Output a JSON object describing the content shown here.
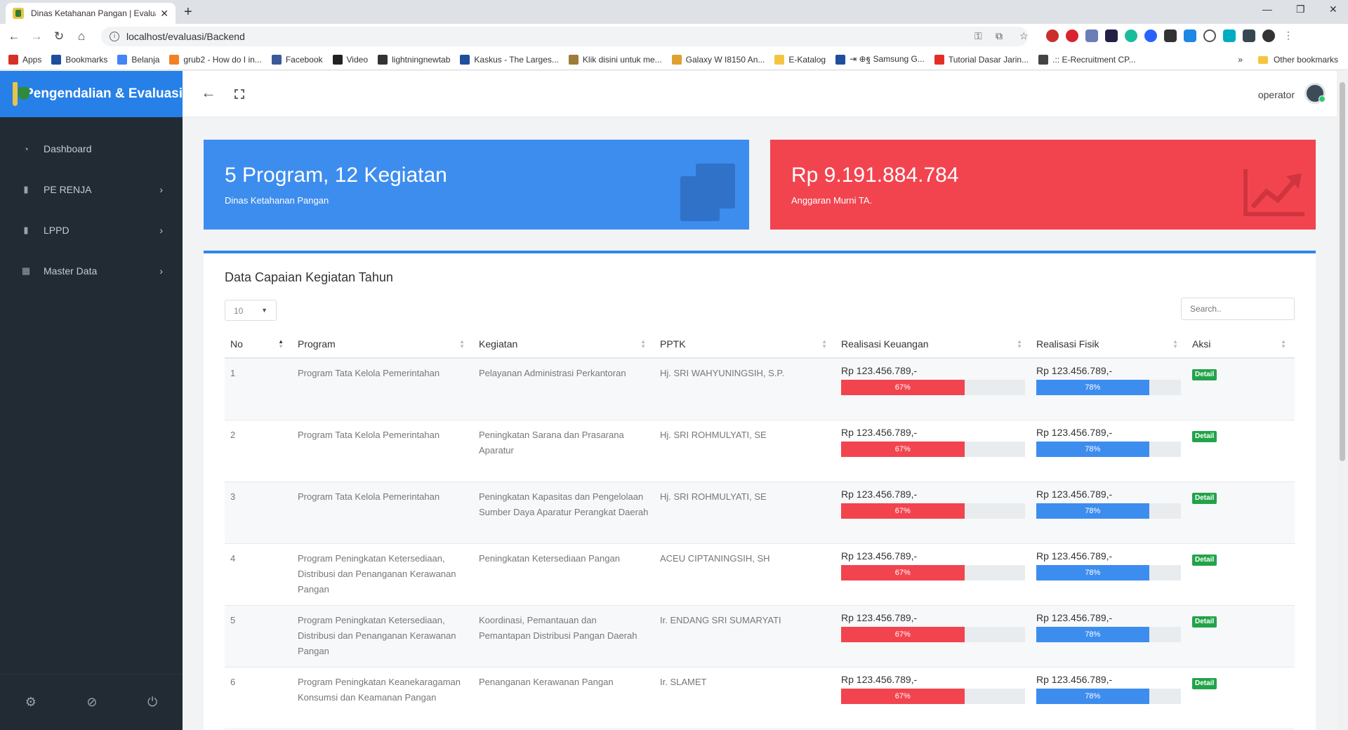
{
  "browser": {
    "tab_title": "Dinas Ketahanan Pangan | Evaluasi",
    "url": "localhost/evaluasi/Backend",
    "bookmarks": [
      {
        "label": "Apps",
        "color": "#d93025"
      },
      {
        "label": "Bookmarks",
        "color": "#1f4e9c"
      },
      {
        "label": "Belanja",
        "color": "#4285f4"
      },
      {
        "label": "grub2 - How do I in...",
        "color": "#f48024"
      },
      {
        "label": "Facebook",
        "color": "#3b5998"
      },
      {
        "label": "Video",
        "color": "#222"
      },
      {
        "label": "lightningnewtab",
        "color": "#333"
      },
      {
        "label": "Kaskus - The Larges...",
        "color": "#1f4e9c"
      },
      {
        "label": "Klik disini untuk me...",
        "color": "#9c7b3b"
      },
      {
        "label": "Galaxy W I8150 An...",
        "color": "#e0a030"
      },
      {
        "label": "E-Katalog",
        "color": "#f5c542"
      },
      {
        "label": "⇥ ⊕ฐ Samsung G...",
        "color": "#1f4e9c"
      },
      {
        "label": "Tutorial Dasar Jarin...",
        "color": "#e52d27"
      },
      {
        "label": ".:: E-Recruitment CP...",
        "color": "#444"
      }
    ],
    "overflow": "»",
    "other_bookmarks": "Other bookmarks"
  },
  "app": {
    "brand": "Pengendalian & Evaluasi",
    "user": "operator"
  },
  "sidebar": {
    "items": [
      {
        "label": "Dashboard",
        "icon": "dashboard-icon",
        "glyph": "◔",
        "has_submenu": false
      },
      {
        "label": "PE RENJA",
        "icon": "bookmark-icon",
        "glyph": "▮",
        "has_submenu": true
      },
      {
        "label": "LPPD",
        "icon": "bookmark-icon",
        "glyph": "▮",
        "has_submenu": true
      },
      {
        "label": "Master Data",
        "icon": "grid-icon",
        "glyph": "▦",
        "has_submenu": true
      }
    ]
  },
  "cards": {
    "program": {
      "value": "5 Program, 12 Kegiatan",
      "subtitle": "Dinas Ketahanan Pangan",
      "color": "#3d8def"
    },
    "budget": {
      "value": "Rp 9.191.884.784",
      "subtitle": "Anggaran Murni TA.",
      "color": "#f2444f"
    }
  },
  "panel": {
    "title": "Data Capaian Kegiatan Tahun",
    "page_size": "10",
    "search_placeholder": "Search.."
  },
  "table": {
    "columns": [
      "No",
      "Program",
      "Kegiatan",
      "PPTK",
      "Realisasi Keuangan",
      "Realisasi Fisik",
      "Aksi"
    ],
    "rows": [
      {
        "no": "1",
        "program": "Program Tata Kelola Pemerintahan",
        "kegiatan": "Pelayanan Administrasi Perkantoran",
        "pptk": "Hj. SRI WAHYUNINGSIH, S.P.",
        "keuangan": "Rp 123.456.789,-",
        "keuangan_pct": 67,
        "keuangan_label": "67%",
        "fisik": "Rp 123.456.789,-",
        "fisik_pct": 78,
        "fisik_label": "78%",
        "aksi": "Detail"
      },
      {
        "no": "2",
        "program": "Program Tata Kelola Pemerintahan",
        "kegiatan": "Peningkatan Sarana dan Prasarana Aparatur",
        "pptk": "Hj. SRI ROHMULYATI, SE",
        "keuangan": "Rp 123.456.789,-",
        "keuangan_pct": 67,
        "keuangan_label": "67%",
        "fisik": "Rp 123.456.789,-",
        "fisik_pct": 78,
        "fisik_label": "78%",
        "aksi": "Detail"
      },
      {
        "no": "3",
        "program": "Program Tata Kelola Pemerintahan",
        "kegiatan": "Peningkatan Kapasitas dan Pengelolaan Sumber Daya Aparatur Perangkat Daerah",
        "pptk": "Hj. SRI ROHMULYATI, SE",
        "keuangan": "Rp 123.456.789,-",
        "keuangan_pct": 67,
        "keuangan_label": "67%",
        "fisik": "Rp 123.456.789,-",
        "fisik_pct": 78,
        "fisik_label": "78%",
        "aksi": "Detail"
      },
      {
        "no": "4",
        "program": "Program Peningkatan Ketersediaan, Distribusi dan Penanganan Kerawanan Pangan",
        "kegiatan": "Peningkatan Ketersediaan Pangan",
        "pptk": "ACEU CIPTANINGSIH, SH",
        "keuangan": "Rp 123.456.789,-",
        "keuangan_pct": 67,
        "keuangan_label": "67%",
        "fisik": "Rp 123.456.789,-",
        "fisik_pct": 78,
        "fisik_label": "78%",
        "aksi": "Detail"
      },
      {
        "no": "5",
        "program": "Program Peningkatan Ketersediaan, Distribusi dan Penanganan Kerawanan Pangan",
        "kegiatan": "Koordinasi, Pemantauan dan Pemantapan Distribusi Pangan Daerah",
        "pptk": "Ir. ENDANG SRI SUMARYATI",
        "keuangan": "Rp 123.456.789,-",
        "keuangan_pct": 67,
        "keuangan_label": "67%",
        "fisik": "Rp 123.456.789,-",
        "fisik_pct": 78,
        "fisik_label": "78%",
        "aksi": "Detail"
      },
      {
        "no": "6",
        "program": "Program Peningkatan Keanekaragaman Konsumsi dan Keamanan Pangan",
        "kegiatan": "Penanganan Kerawanan Pangan",
        "pptk": "Ir. SLAMET",
        "keuangan": "Rp 123.456.789,-",
        "keuangan_pct": 67,
        "keuangan_label": "67%",
        "fisik": "Rp 123.456.789,-",
        "fisik_pct": 78,
        "fisik_label": "78%",
        "aksi": "Detail"
      }
    ]
  }
}
